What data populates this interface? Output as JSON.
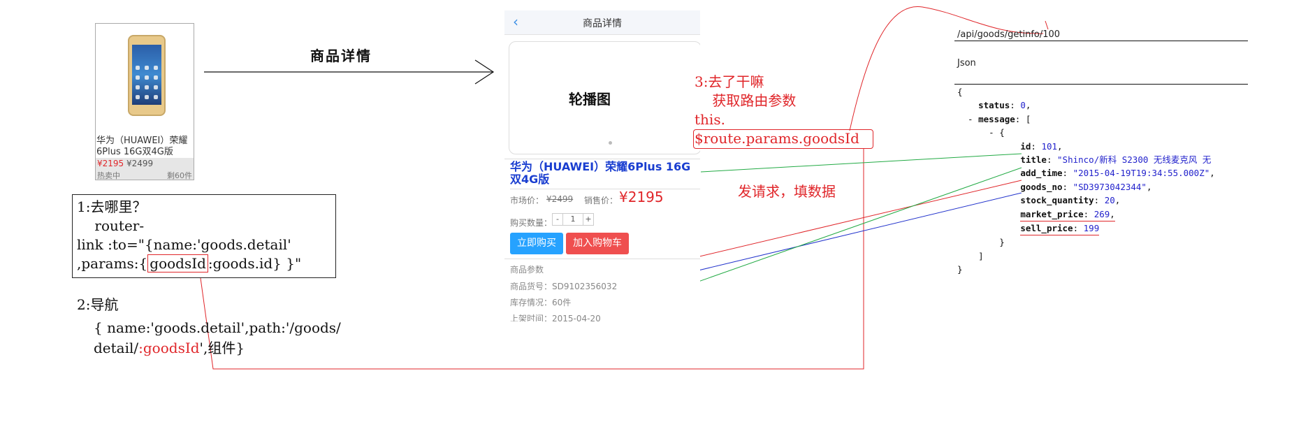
{
  "product_card": {
    "title": "华为（HUAWEI）荣耀6Plus 16G双4G版",
    "price_new": "¥2195",
    "price_old": "¥2499",
    "hot": "热卖中",
    "sold": "剩60件"
  },
  "arrow_caption": "商品详情",
  "step1": {
    "line1": "1:去哪里？",
    "line2": "    router-",
    "line3": "link :to=\"{name:'goods.detail'",
    "line4_pre": ",params:{",
    "line4_box": "goodsId",
    "line4_post": ":goods.id} }\""
  },
  "step2": {
    "title": "2:导航",
    "line1": "{ name:'goods.detail',path:'/goods/",
    "line2_pre": "detail/",
    "line2_red": ":goodsId",
    "line2_post": "',组件}"
  },
  "detail_page": {
    "header_title": "商品详情",
    "carousel": "轮播图",
    "title": "华为（HUAWEI）荣耀6Plus 16G双4G版",
    "market_label": "市场价：",
    "market_price": "¥2499",
    "sell_label": "销售价：",
    "sell_price": "¥2195",
    "qty_label": "购买数量：",
    "qty_minus": "-",
    "qty_value": "1",
    "qty_plus": "+",
    "buy_button": "立即购买",
    "cart_button": "加入购物车",
    "params_title": "商品参数",
    "goods_no": "商品货号：SD9102356032",
    "stock": "库存情况：60件",
    "shelf_time": "上架时间：2015-04-20"
  },
  "step3": {
    "line1": "3:去了干嘛",
    "line2": "    获取路由参数",
    "line3": "this.",
    "line4": "$route.params.goodsId",
    "request": "发请求，填数据"
  },
  "api_panel": {
    "url": "/api/goods/getinfo/100",
    "json_label": "Json",
    "open_brace": "{",
    "status_key": "status",
    "status_val": "0",
    "message_key": "message",
    "id_key": "id",
    "id_val": "101",
    "title_key": "title",
    "title_val": "\"Shinco/新科 S2300 无线麦克风 无",
    "add_time_key": "add_time",
    "add_time_val": "\"2015-04-19T19:34:55.000Z\"",
    "goods_no_key": "goods_no",
    "goods_no_val": "\"SD3973042344\"",
    "stock_key": "stock_quantity",
    "stock_val": "20",
    "market_key": "market_price",
    "market_val": "269",
    "sell_key": "sell_price",
    "sell_val": "199"
  },
  "colors": {
    "red": "#e0262a",
    "blue": "#2222cc",
    "green": "#22aa44",
    "link_blue": "#1a3ed0"
  }
}
